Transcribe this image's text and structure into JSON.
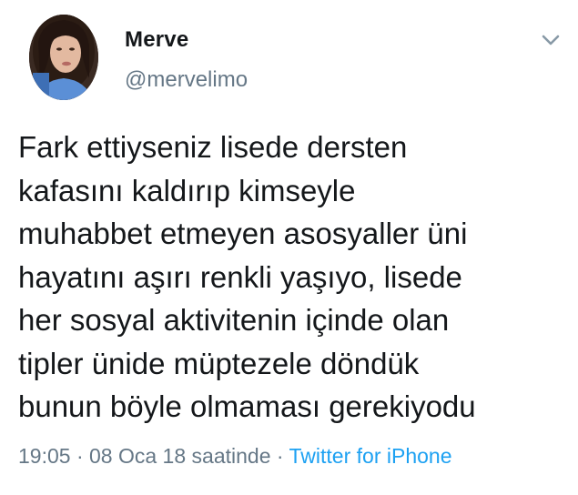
{
  "tweet": {
    "display_name": "Merve",
    "handle": "@mervelimo",
    "text": "Fark ettiyseniz lisede dersten\nkafasını kaldırıp kimseyle\nmuhabbet etmeyen asosyaller üni\nhayatını aşırı renkli yaşıyo, lisede\nher sosyal aktivitenin içinde olan\ntipler ünide müptezele döndük\nbunun böyle olmaması gerekiyodu",
    "time": "19:05",
    "separator": " · ",
    "date": "08 Oca 18 saatinde",
    "source": "Twitter for iPhone"
  },
  "icons": {
    "caret": "chevron-down-icon",
    "avatar": "profile-photo"
  },
  "colors": {
    "text": "#14171a",
    "secondary": "#657786",
    "link": "#1da1f2"
  }
}
